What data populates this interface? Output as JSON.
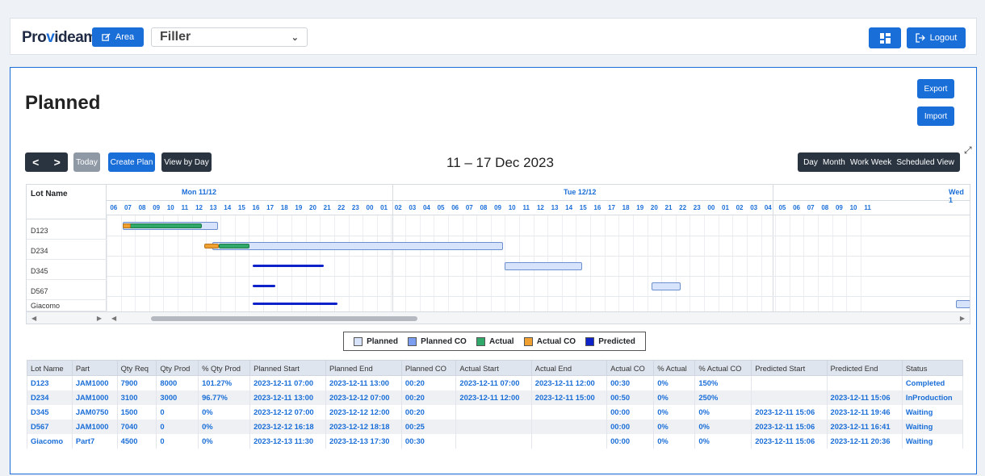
{
  "header": {
    "logo_text": "Provideam",
    "area_label": "Area",
    "area_select_value": "Filler",
    "logout_label": "Logout"
  },
  "page": {
    "title": "Planned",
    "export_label": "Export",
    "import_label": "Import"
  },
  "toolbar": {
    "prev": "<",
    "next": ">",
    "today_label": "Today",
    "create_plan_label": "Create Plan",
    "view_by_day_label": "View by Day",
    "range_title": "11 – 17 Dec 2023",
    "views": [
      "Day",
      "Month",
      "Work Week",
      "Scheduled View"
    ]
  },
  "gantt": {
    "resource_header": "Lot Name",
    "rows": [
      "D123",
      "D234",
      "D345",
      "D567",
      "Giacomo"
    ],
    "days": [
      "Mon 11/12",
      "Tue 12/12",
      "Wed 1"
    ],
    "hours": [
      "06",
      "07",
      "08",
      "09",
      "10",
      "11",
      "12",
      "13",
      "14",
      "15",
      "16",
      "17",
      "18",
      "19",
      "20",
      "21",
      "22",
      "23",
      "00",
      "01",
      "02",
      "03",
      "04",
      "05",
      "06",
      "07",
      "08",
      "09",
      "10",
      "11",
      "12",
      "13",
      "14",
      "15",
      "16",
      "17",
      "18",
      "19",
      "20",
      "21",
      "22",
      "23",
      "00",
      "01",
      "02",
      "03",
      "04",
      "05",
      "06",
      "07",
      "08",
      "09",
      "10",
      "11"
    ]
  },
  "legend": [
    {
      "label": "Planned",
      "color": "#d6e3fa"
    },
    {
      "label": "Planned CO",
      "color": "#7c9ef0"
    },
    {
      "label": "Actual",
      "color": "#2fa86a"
    },
    {
      "label": "Actual CO",
      "color": "#f0a030"
    },
    {
      "label": "Predicted",
      "color": "#0d22c8"
    }
  ],
  "table": {
    "columns": [
      "Lot Name",
      "Part",
      "Qty Req",
      "Qty Prod",
      "% Qty Prod",
      "Planned Start",
      "Planned End",
      "Planned CO",
      "Actual Start",
      "Actual End",
      "Actual CO",
      "% Actual",
      "% Actual CO",
      "Predicted Start",
      "Predicted End",
      "Status"
    ],
    "rows": [
      [
        "D123",
        "JAM1000",
        "7900",
        "8000",
        "101.27%",
        "2023-12-11 07:00",
        "2023-12-11 13:00",
        "00:20",
        "2023-12-11 07:00",
        "2023-12-11 12:00",
        "00:30",
        "0%",
        "150%",
        "",
        "",
        "Completed"
      ],
      [
        "D234",
        "JAM1000",
        "3100",
        "3000",
        "96.77%",
        "2023-12-11 13:00",
        "2023-12-12 07:00",
        "00:20",
        "2023-12-11 12:00",
        "2023-12-11 15:00",
        "00:50",
        "0%",
        "250%",
        "",
        "2023-12-11 15:06",
        "InProduction"
      ],
      [
        "D345",
        "JAM0750",
        "1500",
        "0",
        "0%",
        "2023-12-12 07:00",
        "2023-12-12 12:00",
        "00:20",
        "",
        "",
        "00:00",
        "0%",
        "0%",
        "2023-12-11 15:06",
        "2023-12-11 19:46",
        "Waiting"
      ],
      [
        "D567",
        "JAM1000",
        "7040",
        "0",
        "0%",
        "2023-12-12 16:18",
        "2023-12-12 18:18",
        "00:25",
        "",
        "",
        "00:00",
        "0%",
        "0%",
        "2023-12-11 15:06",
        "2023-12-11 16:41",
        "Waiting"
      ],
      [
        "Giacomo",
        "Part7",
        "4500",
        "0",
        "0%",
        "2023-12-13 11:30",
        "2023-12-13 17:30",
        "00:30",
        "",
        "",
        "00:00",
        "0%",
        "0%",
        "2023-12-11 15:06",
        "2023-12-11 20:36",
        "Waiting"
      ]
    ]
  }
}
